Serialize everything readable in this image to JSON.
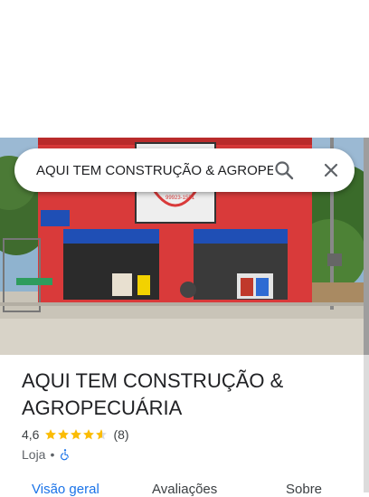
{
  "search": {
    "query": "AQUI TEM CONSTRUÇÃO & AGROPECUÁRIA"
  },
  "place": {
    "name": "AQUI TEM CONSTRUÇÃO & AGROPECUÁRIA",
    "rating": "4,6",
    "rating_fraction": 0.92,
    "review_count": "(8)",
    "category": "Loja",
    "separator": "•"
  },
  "photo": {
    "storefront_phone": "99923-1551"
  },
  "tabs": [
    {
      "label": "Visão geral",
      "active": true
    },
    {
      "label": "Avaliações",
      "active": false
    },
    {
      "label": "Sobre",
      "active": false
    }
  ],
  "icons": {
    "search": "search-icon",
    "close": "close-icon",
    "accessibility": "wheelchair-icon",
    "star": "star-icon"
  },
  "colors": {
    "star": "#fbbc04",
    "accent": "#1a73e8",
    "accessibility": "#1a73e8",
    "storefront_red": "#d93a3a",
    "awning_blue": "#1f4fb5"
  }
}
